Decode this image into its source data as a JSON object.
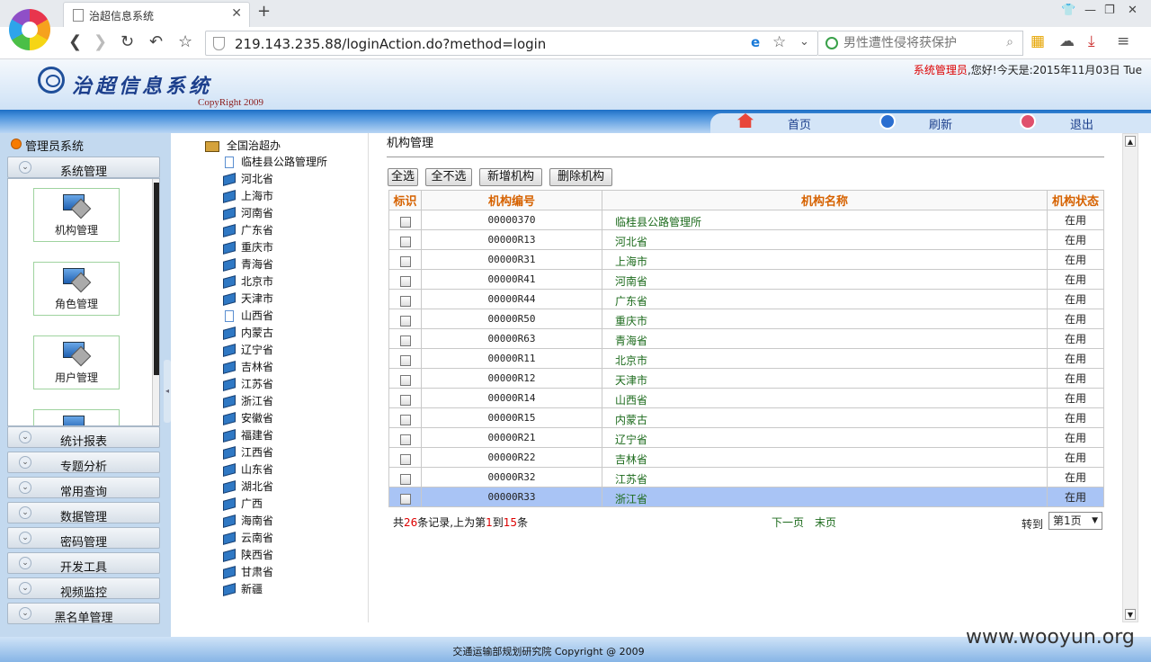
{
  "browser": {
    "tab_title": "治超信息系统",
    "url": "219.143.235.88/loginAction.do?method=login",
    "search_placeholder": "男性遭性侵将获保护"
  },
  "header": {
    "system_title": "治超信息系统",
    "copyright": "CopyRight 2009",
    "user_role": "系统管理员",
    "greeting": ",您好!今天是:2015年11月03日 Tue",
    "nav": {
      "home": "首页",
      "refresh": "刷新",
      "logout": "退出"
    }
  },
  "sidebar": {
    "heading": "管理员系统",
    "sections": [
      {
        "label": "系统管理"
      },
      {
        "label": "统计报表"
      },
      {
        "label": "专题分析"
      },
      {
        "label": "常用查询"
      },
      {
        "label": "数据管理"
      },
      {
        "label": "密码管理"
      },
      {
        "label": "开发工具"
      },
      {
        "label": "视频监控"
      },
      {
        "label": "黑名单管理"
      }
    ],
    "tiles": [
      {
        "label": "机构管理"
      },
      {
        "label": "角色管理"
      },
      {
        "label": "用户管理"
      }
    ]
  },
  "tree": {
    "root": "全国治超办",
    "nodes": [
      {
        "label": "临桂县公路管理所",
        "icon": "page"
      },
      {
        "label": "河北省",
        "icon": "book"
      },
      {
        "label": "上海市",
        "icon": "book"
      },
      {
        "label": "河南省",
        "icon": "book"
      },
      {
        "label": "广东省",
        "icon": "book"
      },
      {
        "label": "重庆市",
        "icon": "book"
      },
      {
        "label": "青海省",
        "icon": "book"
      },
      {
        "label": "北京市",
        "icon": "book"
      },
      {
        "label": "天津市",
        "icon": "book"
      },
      {
        "label": "山西省",
        "icon": "page"
      },
      {
        "label": "内蒙古",
        "icon": "book"
      },
      {
        "label": "辽宁省",
        "icon": "book"
      },
      {
        "label": "吉林省",
        "icon": "book"
      },
      {
        "label": "江苏省",
        "icon": "book"
      },
      {
        "label": "浙江省",
        "icon": "book"
      },
      {
        "label": "安徽省",
        "icon": "book"
      },
      {
        "label": "福建省",
        "icon": "book"
      },
      {
        "label": "江西省",
        "icon": "book"
      },
      {
        "label": "山东省",
        "icon": "book"
      },
      {
        "label": "湖北省",
        "icon": "book"
      },
      {
        "label": "广西",
        "icon": "book"
      },
      {
        "label": "海南省",
        "icon": "book"
      },
      {
        "label": "云南省",
        "icon": "book"
      },
      {
        "label": "陕西省",
        "icon": "book"
      },
      {
        "label": "甘肃省",
        "icon": "book"
      },
      {
        "label": "新疆",
        "icon": "book"
      }
    ]
  },
  "main": {
    "title": "机构管理",
    "buttons": {
      "select_all": "全选",
      "select_none": "全不选",
      "add": "新增机构",
      "delete": "删除机构"
    },
    "columns": [
      "标识",
      "机构编号",
      "机构名称",
      "机构状态"
    ],
    "rows": [
      {
        "code": "00000370",
        "name": "临桂县公路管理所",
        "status": "在用"
      },
      {
        "code": "00000R13",
        "name": "河北省",
        "status": "在用"
      },
      {
        "code": "00000R31",
        "name": "上海市",
        "status": "在用"
      },
      {
        "code": "00000R41",
        "name": "河南省",
        "status": "在用"
      },
      {
        "code": "00000R44",
        "name": "广东省",
        "status": "在用"
      },
      {
        "code": "00000R50",
        "name": "重庆市",
        "status": "在用"
      },
      {
        "code": "00000R63",
        "name": "青海省",
        "status": "在用"
      },
      {
        "code": "00000R11",
        "name": "北京市",
        "status": "在用"
      },
      {
        "code": "00000R12",
        "name": "天津市",
        "status": "在用"
      },
      {
        "code": "00000R14",
        "name": "山西省",
        "status": "在用"
      },
      {
        "code": "00000R15",
        "name": "内蒙古",
        "status": "在用"
      },
      {
        "code": "00000R21",
        "name": "辽宁省",
        "status": "在用"
      },
      {
        "code": "00000R22",
        "name": "吉林省",
        "status": "在用"
      },
      {
        "code": "00000R32",
        "name": "江苏省",
        "status": "在用"
      },
      {
        "code": "00000R33",
        "name": "浙江省",
        "status": "在用"
      }
    ],
    "pager": {
      "p1": "共",
      "total": "26",
      "p2": "条记录,上为第",
      "from": "1",
      "p3": "到",
      "to": "15",
      "p4": "条",
      "next": "下一页",
      "last": "末页",
      "goto": "转到",
      "page_value": "第1页"
    }
  },
  "footer": {
    "text": "交通运输部规划研究院 Copyright @ 2009"
  },
  "watermark": "www.wooyun.org"
}
